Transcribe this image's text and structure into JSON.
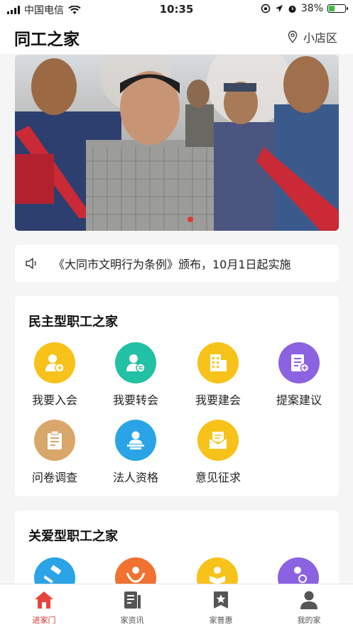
{
  "status_bar": {
    "carrier": "中国电信",
    "time": "10:35",
    "battery": "38%",
    "battery_level": 0.38
  },
  "header": {
    "title": "同工之家",
    "location": "小店区"
  },
  "notice": {
    "text": "《大同市文明行为条例》颁布，10月1日起实施"
  },
  "section_democratic": {
    "title": "民主型职工之家",
    "items": [
      {
        "label": "我要入会",
        "icon": "person-add-icon",
        "color": "#f7c21a"
      },
      {
        "label": "我要转会",
        "icon": "person-transfer-icon",
        "color": "#22c0a4"
      },
      {
        "label": "我要建会",
        "icon": "building-icon",
        "color": "#f7c21a"
      },
      {
        "label": "提案建议",
        "icon": "document-edit-icon",
        "color": "#8b62e0"
      },
      {
        "label": "问卷调查",
        "icon": "clipboard-icon",
        "color": "#d9a769"
      },
      {
        "label": "法人资格",
        "icon": "person-desk-icon",
        "color": "#2aa4e6"
      },
      {
        "label": "意见征求",
        "icon": "mail-icon",
        "color": "#f7c21a"
      }
    ]
  },
  "section_care": {
    "title": "关爱型职工之家"
  },
  "tabs": [
    {
      "label": "进家门",
      "icon": "home-icon",
      "active": true
    },
    {
      "label": "家资讯",
      "icon": "news-icon",
      "active": false
    },
    {
      "label": "家普惠",
      "icon": "star-icon",
      "active": false
    },
    {
      "label": "我的家",
      "icon": "user-icon",
      "active": false
    }
  ]
}
